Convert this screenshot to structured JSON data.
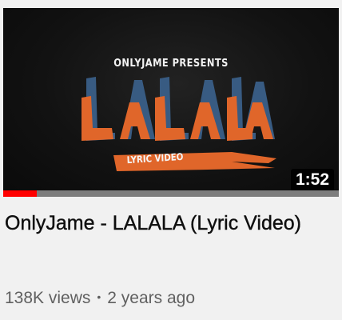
{
  "video": {
    "presents_text": "ONLYJAME PRESENTS",
    "logo_text": "LALALA",
    "tag_text": "LYRIC VIDEO",
    "duration": "1:52",
    "progress_fraction": 0.1,
    "title": "OnlyJame - LALALA (Lyric Video)",
    "views": "138K views",
    "separator": "•",
    "age": "2 years ago"
  },
  "colors": {
    "logo_orange": "#e0662a",
    "logo_blue": "#3a5f88",
    "progress_red": "#ff0000",
    "progress_track": "#7d7d7d"
  }
}
